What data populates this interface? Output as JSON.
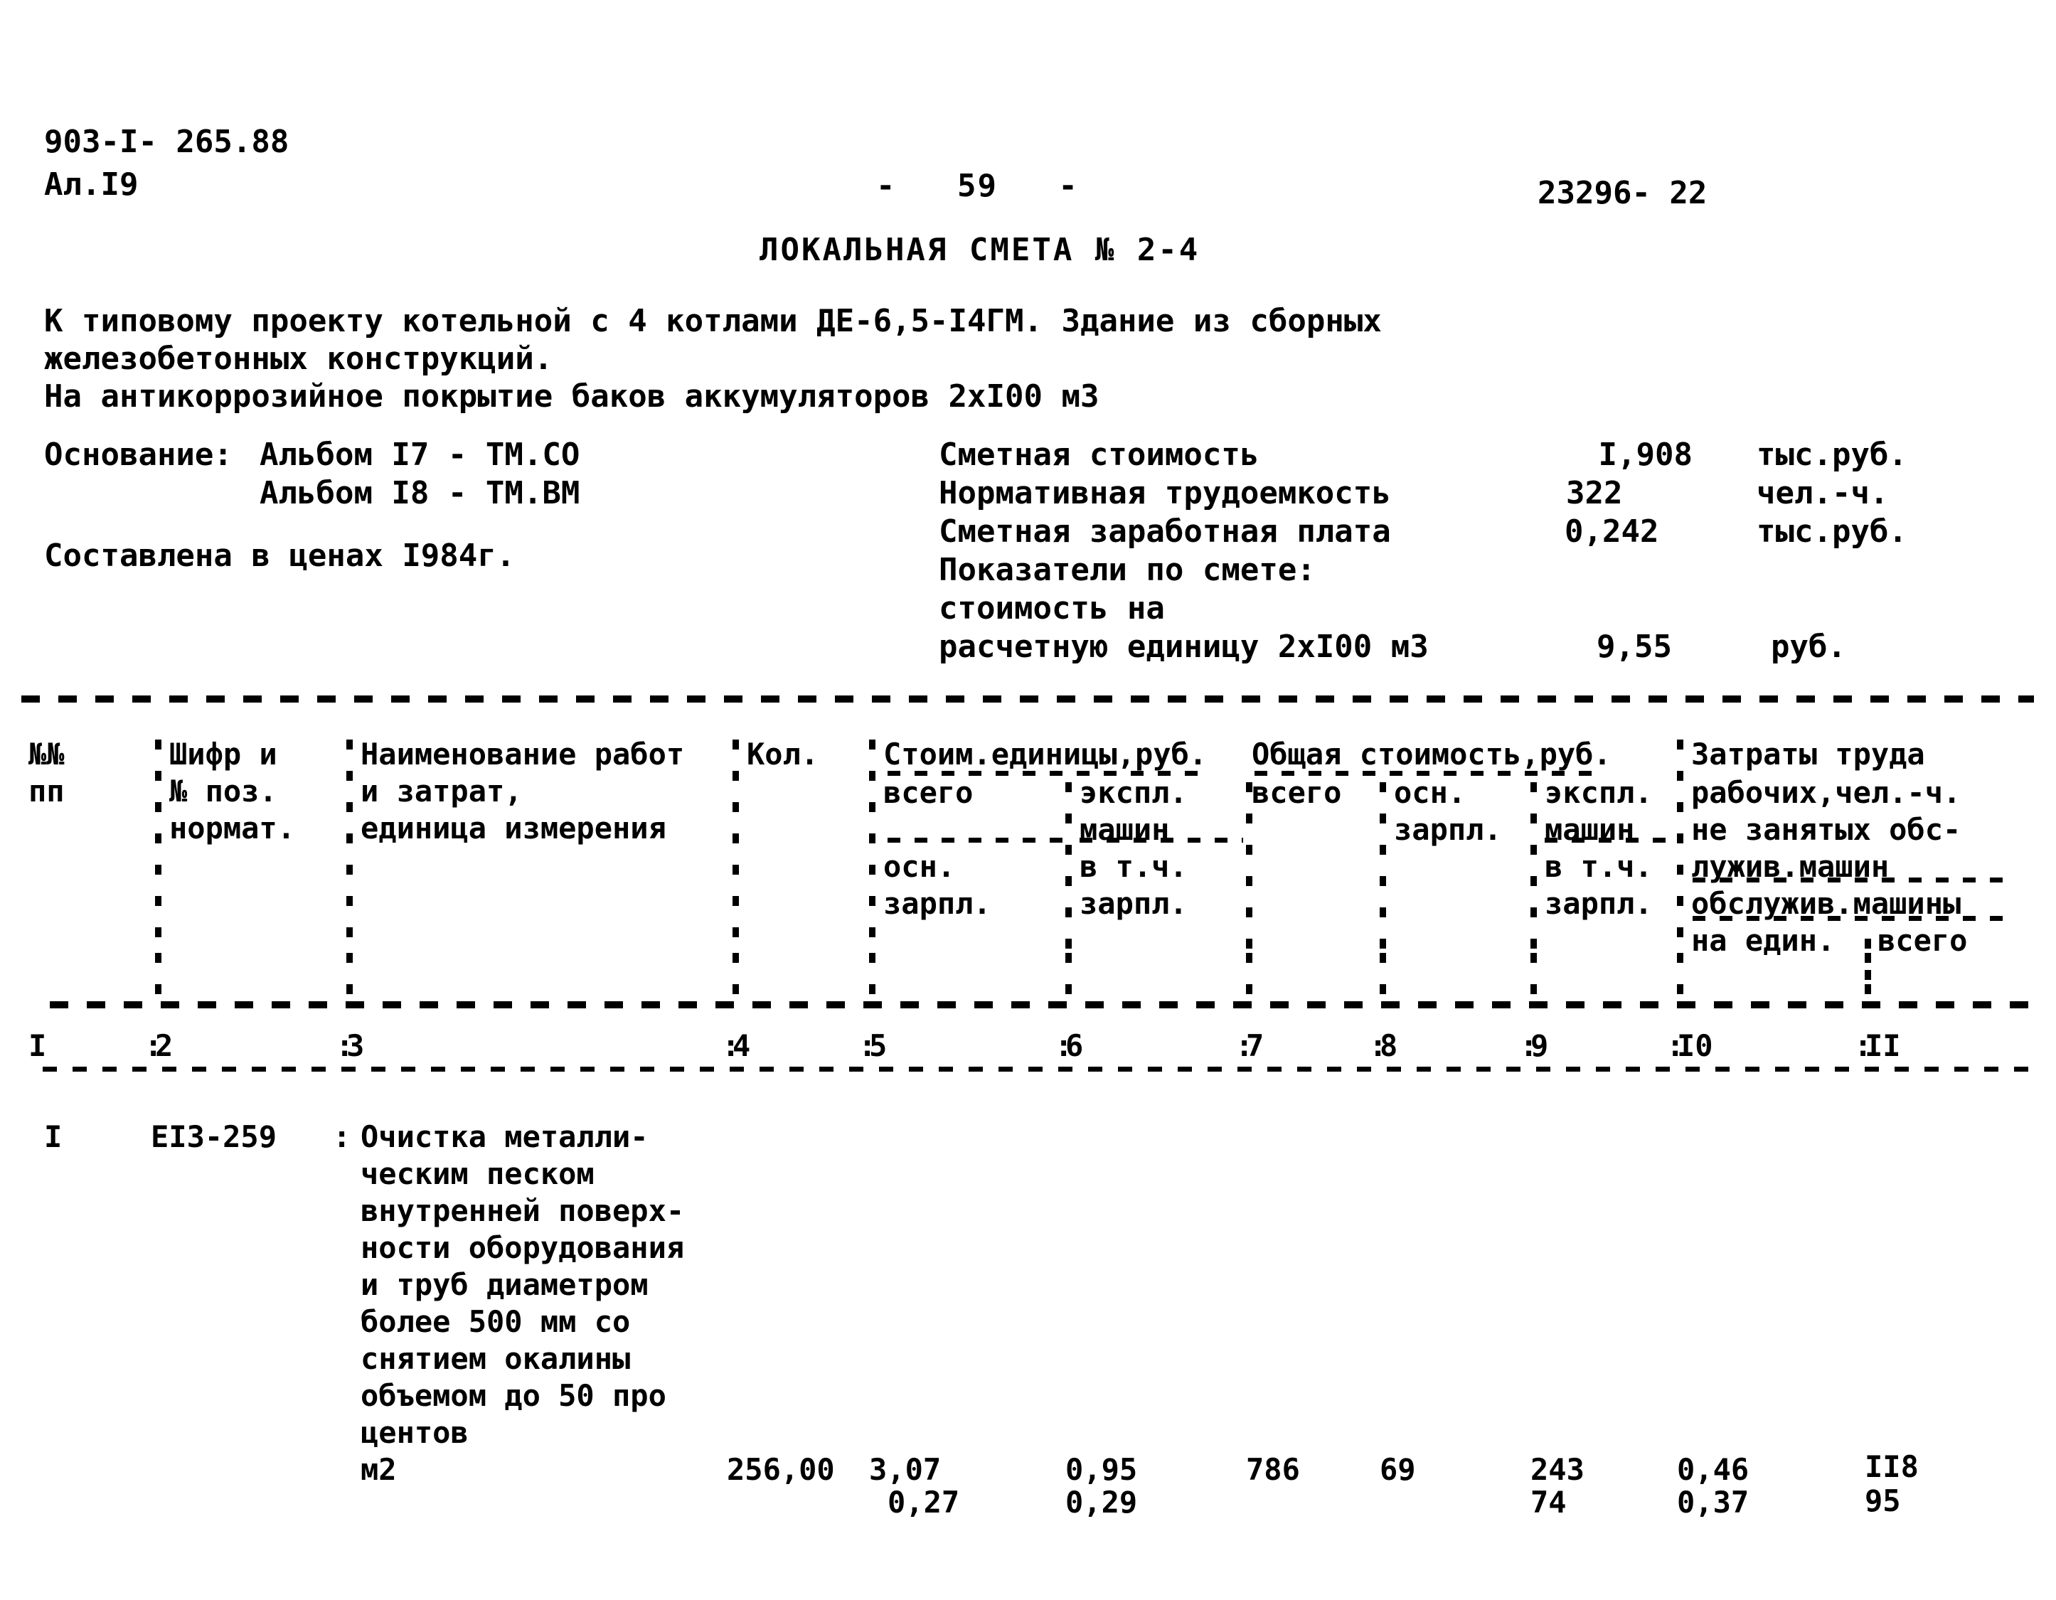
{
  "document": {
    "series_code": "903-I- 265.88",
    "album_line": "Ал.I9",
    "page_marker": "-   59   -",
    "archive_number": "23296- 22",
    "title": "ЛОКАЛЬНАЯ СМЕТА № 2-4"
  },
  "intro": {
    "line1": "К типовому проекту котельной с 4 котлами ДЕ-6,5-I4ГМ. Здание из сборных",
    "line2": "железобетонных конструкций.",
    "line3": "На антикоррозийное покрытие баков аккумуляторов 2хI00 м3"
  },
  "basis": {
    "label": "Основание:",
    "line1": "Альбом I7 - ТМ.СО",
    "line2": "Альбом I8 - ТМ.ВМ",
    "prices_line": "Составлена в ценах I984г."
  },
  "summary": {
    "rows": [
      {
        "label": "Сметная стоимость",
        "value": "I,908",
        "unit": "тыс.руб."
      },
      {
        "label": "Нормативная трудоемкость",
        "value": "322",
        "unit": "чел.-ч."
      },
      {
        "label": "Сметная заработная плата",
        "value": "0,242",
        "unit": "тыс.руб."
      }
    ],
    "indicators_label": "Показатели по смете:",
    "indicator_line1": "стоимость на",
    "indicator_line2": "расчетную единицу 2хI00 м3",
    "indicator_value": "9,55",
    "indicator_unit": "руб."
  },
  "table": {
    "header": {
      "c1_l1": "№№",
      "c1_l2": "пп",
      "c2_l1": "Шифр и",
      "c2_l2": "№ поз.",
      "c2_l3": "нормат.",
      "c3_l1": "Наименование работ",
      "c3_l2": "и затрат,",
      "c3_l3": "единица измерения",
      "c4_l1": "Кол.",
      "g1_title": "Стоим.единицы,руб.",
      "c5_l1": "всего",
      "c5_l2": "осн.",
      "c5_l3": "зарпл.",
      "c6_l1": "экспл.",
      "c6_l2": "машин",
      "c6_l3": "в т.ч.",
      "c6_l4": "зарпл.",
      "g2_title": "Общая стоимость,руб.",
      "c7_l1": "всего",
      "c8_l1": "осн.",
      "c8_l2": "зарпл.",
      "c9_l1": "экспл.",
      "c9_l2": "машин",
      "c9_l3": "в т.ч.",
      "c9_l4": "зарпл.",
      "g3_title": "Затраты труда",
      "c10_l1": "рабочих,чел.-ч.",
      "c10_l2": "не занятых обс-",
      "c10_l3": "лужив.машин",
      "c10_l4": "обслужив.машины",
      "c10_l5": "на един.",
      "c11_l1": "всего"
    },
    "column_numbers": [
      "I",
      "2",
      "3",
      "4",
      "5",
      "6",
      "7",
      "8",
      "9",
      "I0",
      "II"
    ],
    "rows": [
      {
        "num": "I",
        "code": "EI3-259",
        "desc_lines": [
          "Очистка металли-",
          "ческим песком",
          "внутренней поверх-",
          "ности оборудования",
          "и труб диаметром",
          "более 500 мм со",
          "снятием окалины",
          "объемом до 50 про",
          "центов"
        ],
        "unit": "м2",
        "qty": "256,00",
        "unit_cost_total": "3,07",
        "unit_cost_wage": "0,27",
        "unit_mach_total": "0,95",
        "unit_mach_wage": "0,29",
        "total_all": "786",
        "total_main_wage": "69",
        "total_mach": "243",
        "total_mach_wage": "74",
        "labor_per_unit": "0,46",
        "labor_per_unit_serv": "0,37",
        "labor_total": "II8",
        "labor_total_serv": "95"
      }
    ]
  }
}
